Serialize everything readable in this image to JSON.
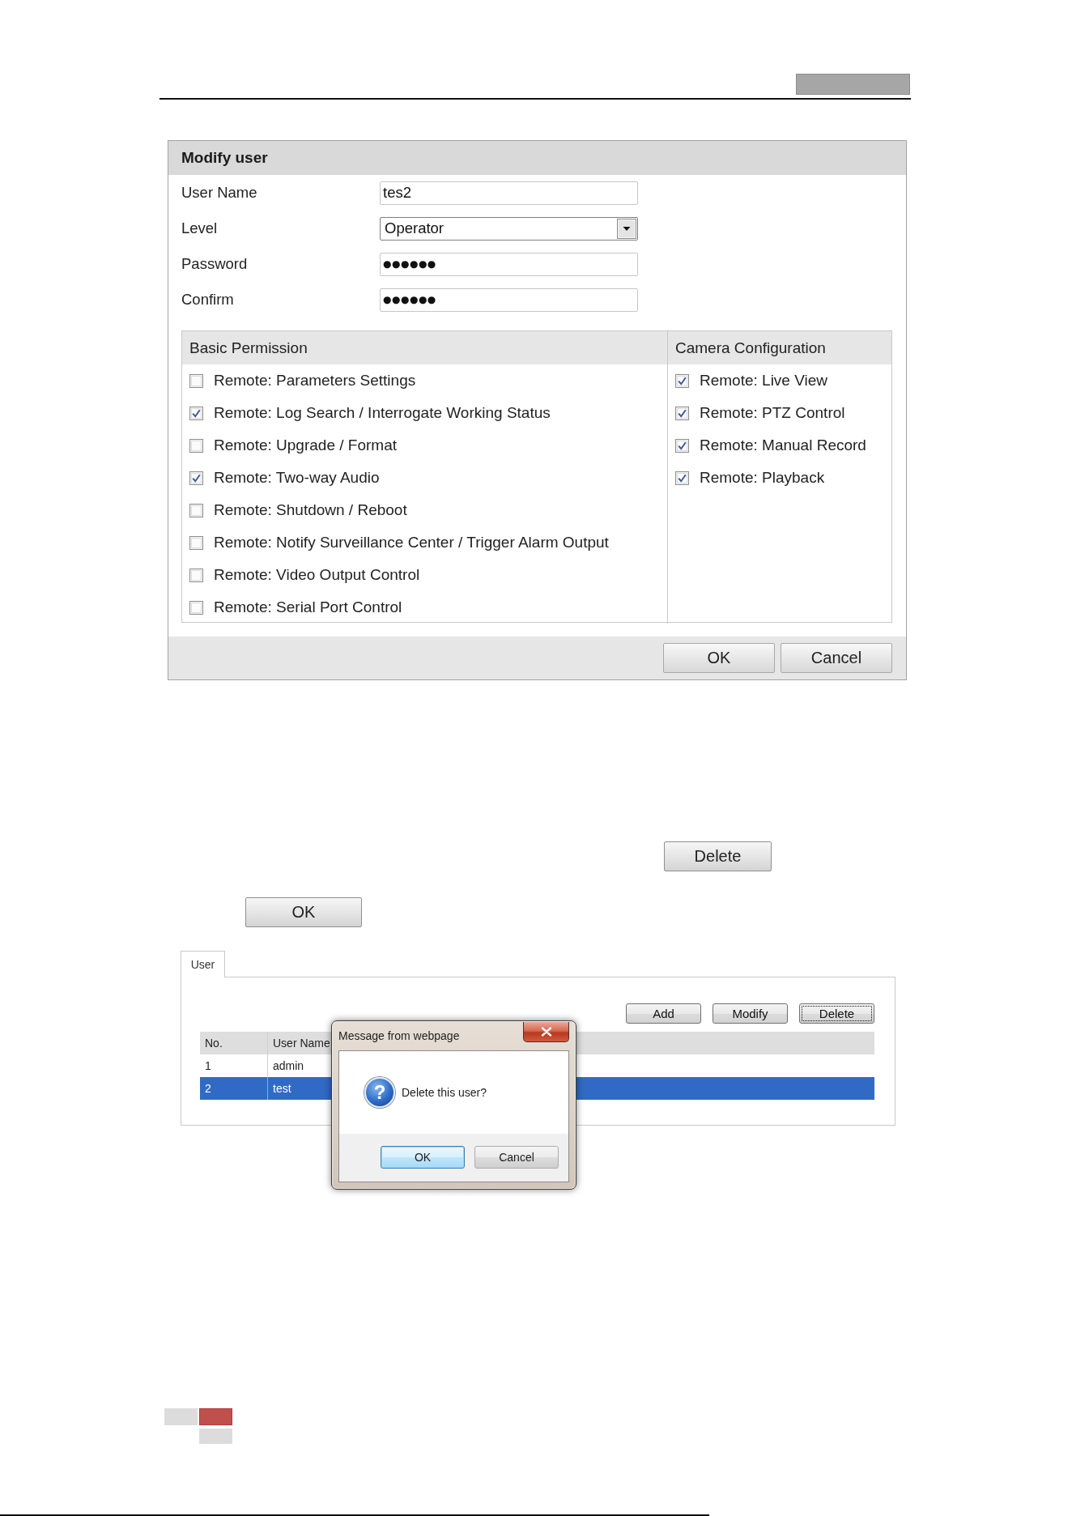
{
  "modify_user": {
    "title": "Modify user",
    "fields": [
      {
        "label": "User Name",
        "kind": "text",
        "value": "tes2"
      },
      {
        "label": "Level",
        "kind": "select",
        "value": "Operator"
      },
      {
        "label": "Password",
        "kind": "password",
        "value": "●●●●●●"
      },
      {
        "label": "Confirm",
        "kind": "password",
        "value": "●●●●●●"
      }
    ],
    "permissions": [
      {
        "title": "Basic Permission",
        "items": [
          {
            "label": "Remote: Parameters Settings",
            "checked": false
          },
          {
            "label": "Remote: Log Search / Interrogate Working Status",
            "checked": true
          },
          {
            "label": "Remote: Upgrade / Format",
            "checked": false
          },
          {
            "label": "Remote: Two-way Audio",
            "checked": true
          },
          {
            "label": "Remote: Shutdown / Reboot",
            "checked": false
          },
          {
            "label": "Remote: Notify Surveillance Center / Trigger Alarm Output",
            "checked": false
          },
          {
            "label": "Remote: Video Output Control",
            "checked": false
          },
          {
            "label": "Remote: Serial Port Control",
            "checked": false
          }
        ]
      },
      {
        "title": "Camera Configuration",
        "items": [
          {
            "label": "Remote: Live View",
            "checked": true
          },
          {
            "label": "Remote: PTZ Control",
            "checked": true
          },
          {
            "label": "Remote: Manual Record",
            "checked": true
          },
          {
            "label": "Remote: Playback",
            "checked": true
          }
        ]
      }
    ],
    "buttons": [
      "OK",
      "Cancel"
    ]
  },
  "figure_buttons": [
    "Delete",
    "OK"
  ],
  "user_panel": {
    "tabs": [
      {
        "label": "User",
        "selected": true
      }
    ],
    "buttons": [
      {
        "label": "Add",
        "focused": false
      },
      {
        "label": "Modify",
        "focused": false
      },
      {
        "label": "Delete",
        "focused": true
      }
    ],
    "table": {
      "columns": [
        "No.",
        "User Name"
      ],
      "rows": [
        {
          "cells": [
            "1",
            "admin"
          ],
          "selected": false
        },
        {
          "cells": [
            "2",
            "test"
          ],
          "selected": true
        }
      ]
    }
  },
  "message_box": {
    "title": "Message from webpage",
    "icon": "?",
    "message": "Delete this user?",
    "buttons": [
      {
        "label": "OK",
        "default": true
      },
      {
        "label": "Cancel",
        "default": false
      }
    ]
  }
}
